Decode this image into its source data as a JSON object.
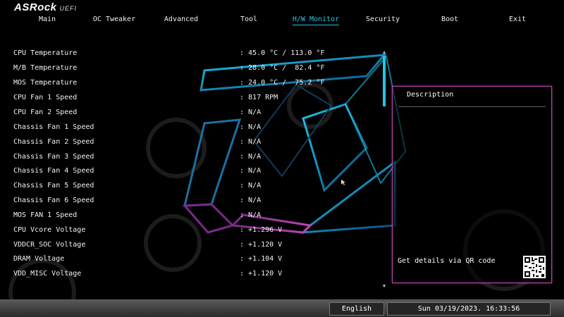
{
  "brand": {
    "name": "ASRock",
    "suffix": "UEFI"
  },
  "nav": {
    "tabs": [
      {
        "label": "Main"
      },
      {
        "label": "OC Tweaker"
      },
      {
        "label": "Advanced"
      },
      {
        "label": "Tool"
      },
      {
        "label": "H/W Monitor",
        "active": true
      },
      {
        "label": "Security"
      },
      {
        "label": "Boot"
      },
      {
        "label": "Exit"
      }
    ]
  },
  "monitor": {
    "rows": [
      {
        "label": "CPU Temperature",
        "value": ": 45.0 °C / 113.0 °F"
      },
      {
        "label": "M/B Temperature",
        "value": ": 28.0 °C /  82.4 °F"
      },
      {
        "label": "MOS Temperature",
        "value": ": 24.0 °C /  75.2 °F"
      },
      {
        "label": "CPU Fan 1 Speed",
        "value": ": 817 RPM"
      },
      {
        "label": "CPU Fan 2 Speed",
        "value": ": N/A"
      },
      {
        "label": "Chassis Fan 1 Speed",
        "value": ": N/A"
      },
      {
        "label": "Chassis Fan 2 Speed",
        "value": ": N/A"
      },
      {
        "label": "Chassis Fan 3 Speed",
        "value": ": N/A"
      },
      {
        "label": "Chassis Fan 4 Speed",
        "value": ": N/A"
      },
      {
        "label": "Chassis Fan 5 Speed",
        "value": ": N/A"
      },
      {
        "label": "Chassis Fan 6 Speed",
        "value": ": N/A"
      },
      {
        "label": "MOS FAN 1 Speed",
        "value": ": N/A"
      },
      {
        "label": "CPU Vcore Voltage",
        "value": ": +1.296 V"
      },
      {
        "label": "VDDCR_SOC Voltage",
        "value": ": +1.120 V"
      },
      {
        "label": "DRAM Voltage",
        "value": ": +1.104 V"
      },
      {
        "label": "VDD_MISC Voltage",
        "value": ": +1.120 V"
      }
    ]
  },
  "description": {
    "title": "Description",
    "qr_text": "Get details via QR code"
  },
  "status": {
    "language": "English",
    "datetime": "Sun 03/19/2023. 16:33:56"
  },
  "colors": {
    "accent": "#27c4e8",
    "desc_border": "#c046b0"
  }
}
